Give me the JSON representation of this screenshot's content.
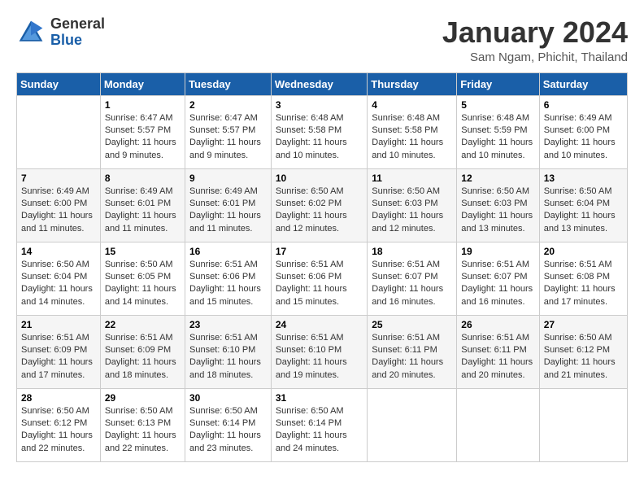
{
  "logo": {
    "general": "General",
    "blue": "Blue"
  },
  "title": "January 2024",
  "location": "Sam Ngam, Phichit, Thailand",
  "days_of_week": [
    "Sunday",
    "Monday",
    "Tuesday",
    "Wednesday",
    "Thursday",
    "Friday",
    "Saturday"
  ],
  "weeks": [
    [
      {
        "day": "",
        "sunrise": "",
        "sunset": "",
        "daylight": ""
      },
      {
        "day": "1",
        "sunrise": "Sunrise: 6:47 AM",
        "sunset": "Sunset: 5:57 PM",
        "daylight": "Daylight: 11 hours and 9 minutes."
      },
      {
        "day": "2",
        "sunrise": "Sunrise: 6:47 AM",
        "sunset": "Sunset: 5:57 PM",
        "daylight": "Daylight: 11 hours and 9 minutes."
      },
      {
        "day": "3",
        "sunrise": "Sunrise: 6:48 AM",
        "sunset": "Sunset: 5:58 PM",
        "daylight": "Daylight: 11 hours and 10 minutes."
      },
      {
        "day": "4",
        "sunrise": "Sunrise: 6:48 AM",
        "sunset": "Sunset: 5:58 PM",
        "daylight": "Daylight: 11 hours and 10 minutes."
      },
      {
        "day": "5",
        "sunrise": "Sunrise: 6:48 AM",
        "sunset": "Sunset: 5:59 PM",
        "daylight": "Daylight: 11 hours and 10 minutes."
      },
      {
        "day": "6",
        "sunrise": "Sunrise: 6:49 AM",
        "sunset": "Sunset: 6:00 PM",
        "daylight": "Daylight: 11 hours and 10 minutes."
      }
    ],
    [
      {
        "day": "7",
        "sunrise": "Sunrise: 6:49 AM",
        "sunset": "Sunset: 6:00 PM",
        "daylight": "Daylight: 11 hours and 11 minutes."
      },
      {
        "day": "8",
        "sunrise": "Sunrise: 6:49 AM",
        "sunset": "Sunset: 6:01 PM",
        "daylight": "Daylight: 11 hours and 11 minutes."
      },
      {
        "day": "9",
        "sunrise": "Sunrise: 6:49 AM",
        "sunset": "Sunset: 6:01 PM",
        "daylight": "Daylight: 11 hours and 11 minutes."
      },
      {
        "day": "10",
        "sunrise": "Sunrise: 6:50 AM",
        "sunset": "Sunset: 6:02 PM",
        "daylight": "Daylight: 11 hours and 12 minutes."
      },
      {
        "day": "11",
        "sunrise": "Sunrise: 6:50 AM",
        "sunset": "Sunset: 6:03 PM",
        "daylight": "Daylight: 11 hours and 12 minutes."
      },
      {
        "day": "12",
        "sunrise": "Sunrise: 6:50 AM",
        "sunset": "Sunset: 6:03 PM",
        "daylight": "Daylight: 11 hours and 13 minutes."
      },
      {
        "day": "13",
        "sunrise": "Sunrise: 6:50 AM",
        "sunset": "Sunset: 6:04 PM",
        "daylight": "Daylight: 11 hours and 13 minutes."
      }
    ],
    [
      {
        "day": "14",
        "sunrise": "Sunrise: 6:50 AM",
        "sunset": "Sunset: 6:04 PM",
        "daylight": "Daylight: 11 hours and 14 minutes."
      },
      {
        "day": "15",
        "sunrise": "Sunrise: 6:50 AM",
        "sunset": "Sunset: 6:05 PM",
        "daylight": "Daylight: 11 hours and 14 minutes."
      },
      {
        "day": "16",
        "sunrise": "Sunrise: 6:51 AM",
        "sunset": "Sunset: 6:06 PM",
        "daylight": "Daylight: 11 hours and 15 minutes."
      },
      {
        "day": "17",
        "sunrise": "Sunrise: 6:51 AM",
        "sunset": "Sunset: 6:06 PM",
        "daylight": "Daylight: 11 hours and 15 minutes."
      },
      {
        "day": "18",
        "sunrise": "Sunrise: 6:51 AM",
        "sunset": "Sunset: 6:07 PM",
        "daylight": "Daylight: 11 hours and 16 minutes."
      },
      {
        "day": "19",
        "sunrise": "Sunrise: 6:51 AM",
        "sunset": "Sunset: 6:07 PM",
        "daylight": "Daylight: 11 hours and 16 minutes."
      },
      {
        "day": "20",
        "sunrise": "Sunrise: 6:51 AM",
        "sunset": "Sunset: 6:08 PM",
        "daylight": "Daylight: 11 hours and 17 minutes."
      }
    ],
    [
      {
        "day": "21",
        "sunrise": "Sunrise: 6:51 AM",
        "sunset": "Sunset: 6:09 PM",
        "daylight": "Daylight: 11 hours and 17 minutes."
      },
      {
        "day": "22",
        "sunrise": "Sunrise: 6:51 AM",
        "sunset": "Sunset: 6:09 PM",
        "daylight": "Daylight: 11 hours and 18 minutes."
      },
      {
        "day": "23",
        "sunrise": "Sunrise: 6:51 AM",
        "sunset": "Sunset: 6:10 PM",
        "daylight": "Daylight: 11 hours and 18 minutes."
      },
      {
        "day": "24",
        "sunrise": "Sunrise: 6:51 AM",
        "sunset": "Sunset: 6:10 PM",
        "daylight": "Daylight: 11 hours and 19 minutes."
      },
      {
        "day": "25",
        "sunrise": "Sunrise: 6:51 AM",
        "sunset": "Sunset: 6:11 PM",
        "daylight": "Daylight: 11 hours and 20 minutes."
      },
      {
        "day": "26",
        "sunrise": "Sunrise: 6:51 AM",
        "sunset": "Sunset: 6:11 PM",
        "daylight": "Daylight: 11 hours and 20 minutes."
      },
      {
        "day": "27",
        "sunrise": "Sunrise: 6:50 AM",
        "sunset": "Sunset: 6:12 PM",
        "daylight": "Daylight: 11 hours and 21 minutes."
      }
    ],
    [
      {
        "day": "28",
        "sunrise": "Sunrise: 6:50 AM",
        "sunset": "Sunset: 6:12 PM",
        "daylight": "Daylight: 11 hours and 22 minutes."
      },
      {
        "day": "29",
        "sunrise": "Sunrise: 6:50 AM",
        "sunset": "Sunset: 6:13 PM",
        "daylight": "Daylight: 11 hours and 22 minutes."
      },
      {
        "day": "30",
        "sunrise": "Sunrise: 6:50 AM",
        "sunset": "Sunset: 6:14 PM",
        "daylight": "Daylight: 11 hours and 23 minutes."
      },
      {
        "day": "31",
        "sunrise": "Sunrise: 6:50 AM",
        "sunset": "Sunset: 6:14 PM",
        "daylight": "Daylight: 11 hours and 24 minutes."
      },
      {
        "day": "",
        "sunrise": "",
        "sunset": "",
        "daylight": ""
      },
      {
        "day": "",
        "sunrise": "",
        "sunset": "",
        "daylight": ""
      },
      {
        "day": "",
        "sunrise": "",
        "sunset": "",
        "daylight": ""
      }
    ]
  ]
}
